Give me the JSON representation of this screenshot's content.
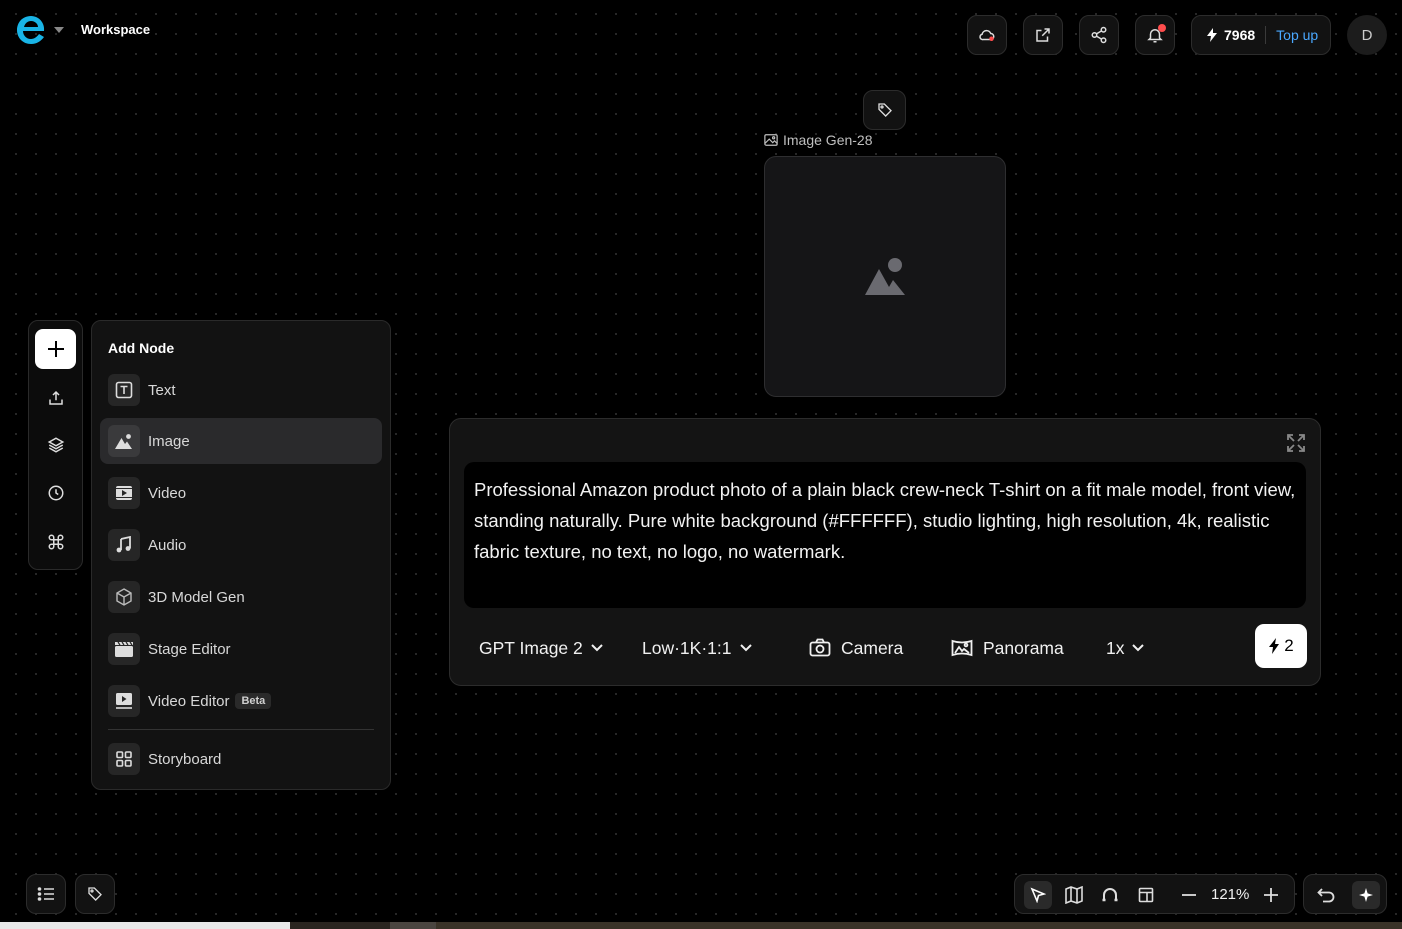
{
  "header": {
    "workspace_title": "Workspace",
    "credits": "7968",
    "topup_label": "Top up",
    "avatar_initial": "D",
    "icons": [
      "cloud-sync-icon",
      "open-external-icon",
      "share-icon",
      "bell-icon",
      "bolt-icon"
    ]
  },
  "left_toolbar": {
    "icons": [
      "plus-icon",
      "upload-icon",
      "layers-icon",
      "history-icon",
      "command-icon"
    ]
  },
  "add_node": {
    "title": "Add Node",
    "items": [
      {
        "label": "Text",
        "icon": "text-icon"
      },
      {
        "label": "Image",
        "icon": "image-icon",
        "active": true
      },
      {
        "label": "Video",
        "icon": "video-icon"
      },
      {
        "label": "Audio",
        "icon": "music-note-icon"
      },
      {
        "label": "3D Model Gen",
        "icon": "cube-icon"
      },
      {
        "label": "Stage Editor",
        "icon": "clapperboard-icon"
      },
      {
        "label": "Video Editor",
        "icon": "video-editor-icon",
        "badge": "Beta"
      },
      {
        "label": "Storyboard",
        "icon": "grid-icon"
      }
    ]
  },
  "image_node": {
    "label": "Image Gen-28"
  },
  "prompt": {
    "text": "Professional Amazon product photo of a plain black crew-neck T-shirt on a fit male model, front view, standing naturally. Pure white background (#FFFFFF), studio lighting, high resolution, 4k, realistic fabric texture, no text, no logo, no watermark.",
    "model": "GPT Image 2",
    "quality": "Low·1K·1:1",
    "camera": "Camera",
    "panorama": "Panorama",
    "count": "1x",
    "cost": "2"
  },
  "bottom_bar": {
    "zoom": "121%"
  },
  "colors": {
    "accent_link": "#4aa8ff",
    "notification": "#ff4d4d",
    "logo": "#19b4e6"
  }
}
